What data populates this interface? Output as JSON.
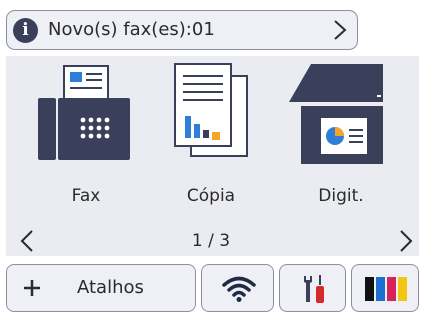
{
  "notification": {
    "text": "Novo(s) fax(es):01",
    "icon": "info-icon"
  },
  "apps": [
    {
      "label": "Fax",
      "icon": "fax-machine-icon"
    },
    {
      "label": "Cópia",
      "icon": "copy-documents-icon"
    },
    {
      "label": "Digit.",
      "icon": "scanner-icon"
    }
  ],
  "pagination": {
    "indicator": "1 / 3"
  },
  "bottom_bar": {
    "shortcuts_label": "Atalhos",
    "shortcuts_icon": "plus-icon",
    "wifi_icon": "wifi-icon",
    "settings_icon": "settings-tools-icon",
    "ink_icon": "ink-cartridge-icon"
  },
  "colors": {
    "panel_bg": "#eaecf1",
    "button_bg": "#eef0f5",
    "border": "#8d909c",
    "icon_dark": "#3a3f5a",
    "accent_blue": "#2f7fd8",
    "accent_orange": "#f5a623",
    "ink_black": "#111111",
    "ink_cyan": "#1a6fd1",
    "ink_magenta": "#d6245a",
    "ink_yellow": "#f3c613"
  }
}
